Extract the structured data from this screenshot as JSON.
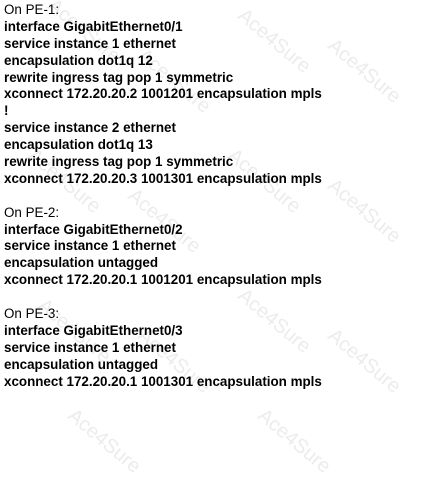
{
  "watermark": "Ace4Sure",
  "sections": [
    {
      "header": "On PE-1:",
      "lines": [
        "interface GigabitEthernet0/1",
        "service instance 1 ethernet",
        "encapsulation dot1q 12",
        "rewrite ingress tag pop 1 symmetric",
        "xconnect 172.20.20.2 1001201 encapsulation mpls",
        "!",
        "service instance 2 ethernet",
        "encapsulation dot1q 13",
        "rewrite ingress tag pop 1 symmetric",
        "xconnect 172.20.20.3 1001301 encapsulation mpls"
      ]
    },
    {
      "header": "On PE-2:",
      "lines": [
        "interface GigabitEthernet0/2",
        "service instance 1 ethernet",
        "encapsulation untagged",
        "xconnect 172.20.20.1 1001201 encapsulation mpls"
      ]
    },
    {
      "header": "On PE-3:",
      "lines": [
        "interface GigabitEthernet0/3",
        "service instance 1 ethernet",
        "encapsulation untagged",
        "xconnect 172.20.20.1 1001301 encapsulation mpls"
      ]
    }
  ]
}
